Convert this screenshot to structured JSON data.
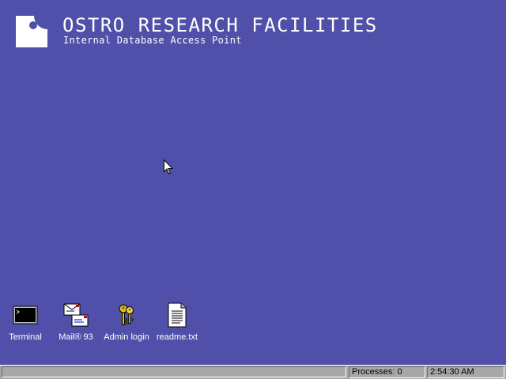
{
  "header": {
    "title": "OSTRO RESEARCH FACILITIES",
    "subtitle": "Internal Database Access Point",
    "logo_icon": "ostro-logo-icon"
  },
  "desktop": {
    "background_color": "#5050aa",
    "icons": [
      {
        "label": "Terminal",
        "icon": "terminal-icon"
      },
      {
        "label": "Mail® 93",
        "icon": "mail-icon"
      },
      {
        "label": "Admin login",
        "icon": "keys-icon"
      },
      {
        "label": "readme.txt",
        "icon": "text-file-icon"
      }
    ]
  },
  "taskbar": {
    "processes": "Processes: 0",
    "clock": "2:54:30 AM"
  }
}
